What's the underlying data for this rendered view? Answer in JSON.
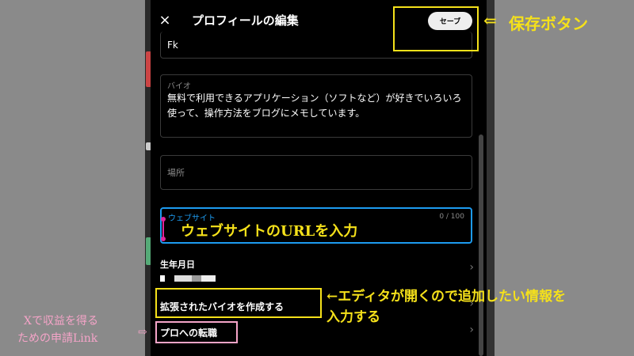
{
  "header": {
    "title": "プロフィールの編集",
    "save_label": "セーブ",
    "close_icon": "×"
  },
  "fields": {
    "name_value": "Fk",
    "bio_label": "バイオ",
    "bio_value": "無料で利用できるアプリケーション（ソフトなど）が好きでいろいろ使って、操作方法をブログにメモしています。",
    "location_label": "場所",
    "website_label": "ウェブサイト",
    "website_counter": "0 / 100"
  },
  "rows": {
    "birthday_label": "生年月日",
    "expanded_bio_label": "拡張されたバイオを作成する",
    "pro_label": "プロへの転職",
    "chevron": "›"
  },
  "annotations": {
    "save_button_note": "保存ボタン",
    "website_note": "ウェブサイトのURLを入力",
    "editor_note_line1": "←エディタが開くので追加したい情報を",
    "editor_note_line2": "入力する",
    "pro_note_line1": "Xで収益を得る",
    "pro_note_line2": "ための申請Link",
    "arrow_left": "⇐",
    "arrow_right": "⇨"
  },
  "colors": {
    "annotation_yellow": "#f5e11a",
    "annotation_pink": "#f5a4c8",
    "focus_blue": "#1d9bf0"
  }
}
